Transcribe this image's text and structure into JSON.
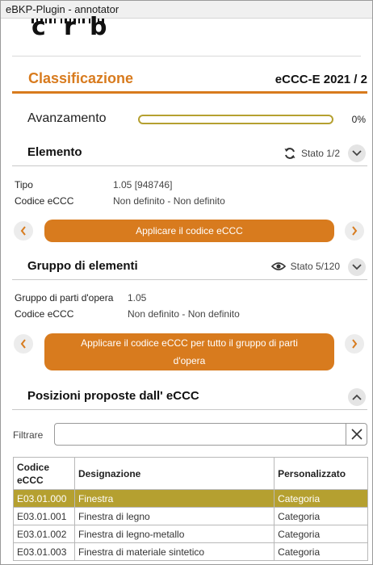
{
  "window": {
    "title": "eBKP-Plugin - annotator"
  },
  "logo": {
    "letters": [
      "c",
      "r",
      "b"
    ]
  },
  "header": {
    "title": "Classificazione",
    "version": "eCCC-E 2021 / 2"
  },
  "progress": {
    "label": "Avanzamento",
    "value": 0,
    "value_label": "0%"
  },
  "element_section": {
    "title": "Elemento",
    "state": "Stato 1/2",
    "state_icon": "sync-icon",
    "rows": [
      {
        "key": "Tipo",
        "value": "1.05 [948746]"
      },
      {
        "key": "Codice eCCC",
        "value": "Non definito - Non definito"
      }
    ],
    "apply_label": "Applicare il codice eCCC"
  },
  "group_section": {
    "title": "Gruppo di elementi",
    "state": "Stato 5/120",
    "state_icon": "eye-icon",
    "rows": [
      {
        "key": "Gruppo di parti d'opera",
        "value": "1.05"
      },
      {
        "key": "Codice eCCC",
        "value": "Non definito - Non definito"
      }
    ],
    "apply_label_line1": "Applicare il codice eCCC per tutto il gruppo di parti",
    "apply_label_line2": "d'opera"
  },
  "positions_section": {
    "title": "Posizioni proposte dall' eCCC",
    "filter_label": "Filtrare",
    "filter_value": "",
    "columns": {
      "code_line1": "Codice",
      "code_line2": "eCCC",
      "designation": "Designazione",
      "custom": "Personalizzato"
    },
    "rows": [
      {
        "code": "E03.01.000",
        "designation": "Finestra",
        "custom": "Categoria"
      },
      {
        "code": "E03.01.001",
        "designation": "Finestra di legno",
        "custom": "Categoria"
      },
      {
        "code": "E03.01.002",
        "designation": "Finestra di legno-metallo",
        "custom": "Categoria"
      },
      {
        "code": "E03.01.003",
        "designation": "Finestra di materiale sintetico",
        "custom": "Categoria"
      }
    ]
  },
  "colors": {
    "accent": "#d87b1e",
    "progress": "#b5a030",
    "selected_row": "#b5a030"
  }
}
